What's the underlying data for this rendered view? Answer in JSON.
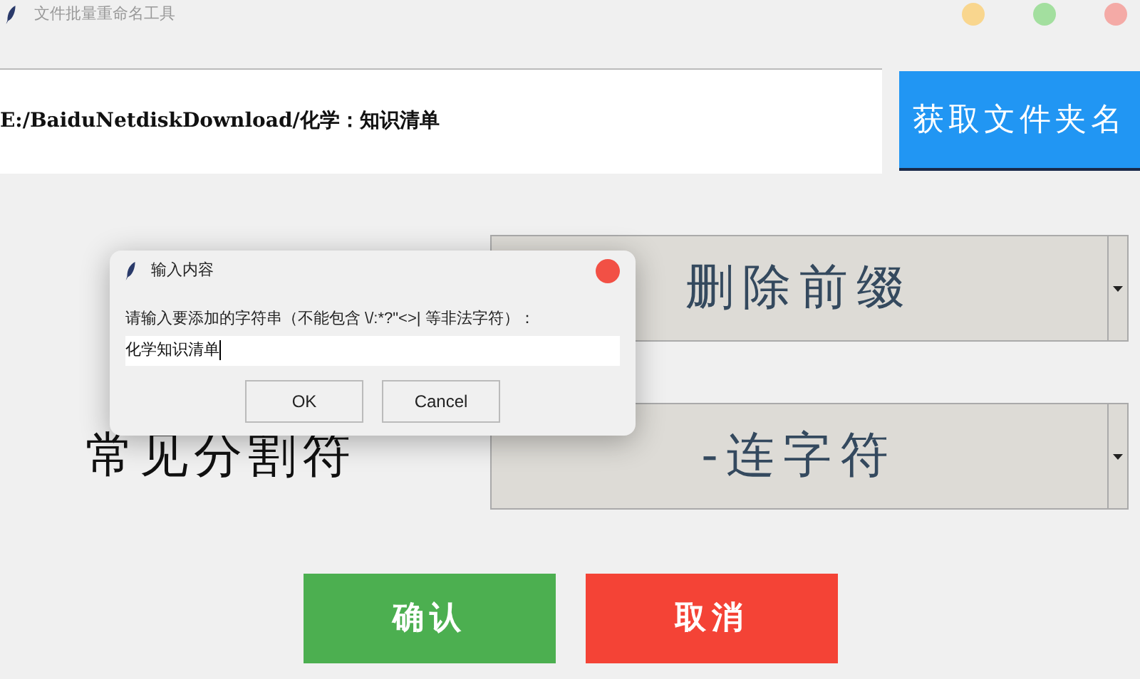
{
  "window": {
    "title": "文件批量重命名工具"
  },
  "path_field": {
    "value": "E:/BaiduNetdiskDownload/化学：知识清单"
  },
  "get_folder_button": {
    "label": "获取文件夹名"
  },
  "rows": [
    {
      "value": "删除前缀"
    },
    {
      "label": "常见分割符",
      "value": "-连字符"
    }
  ],
  "actions": [
    {
      "label": "确认",
      "kind": "confirm"
    },
    {
      "label": "取消",
      "kind": "cancel"
    }
  ],
  "dialog": {
    "title": "输入内容",
    "prompt": "请输入要添加的字符串（不能包含 \\/:*?\"<>| 等非法字符）：",
    "value": "化学知识清单",
    "buttons": [
      "OK",
      "Cancel"
    ]
  }
}
